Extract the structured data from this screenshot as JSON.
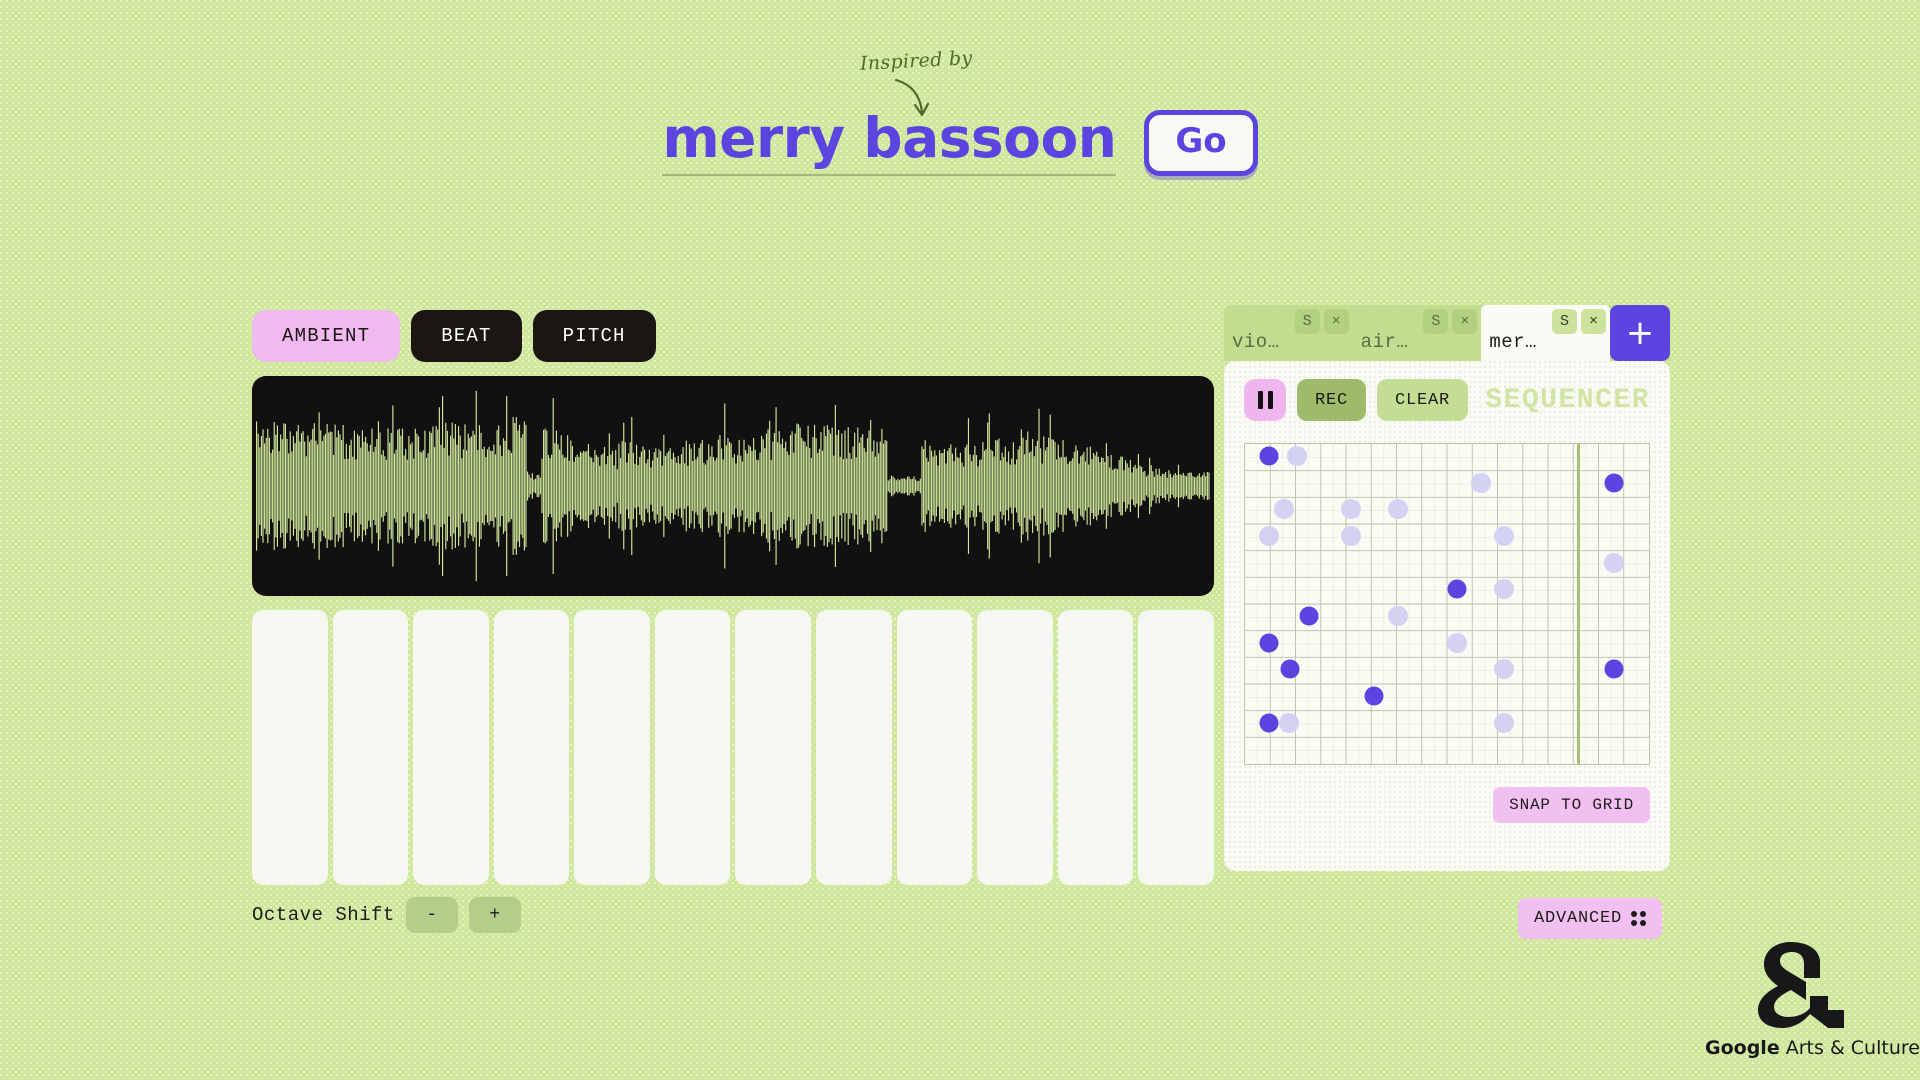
{
  "header": {
    "inspired_label": "Inspired by",
    "title": "merry bassoon",
    "go_label": "Go"
  },
  "left_panel": {
    "mode_tabs": [
      {
        "label": "AMBIENT",
        "active": true
      },
      {
        "label": "BEAT",
        "active": false
      },
      {
        "label": "PITCH",
        "active": false
      }
    ],
    "waveform": {
      "name": "audio-waveform",
      "background_color": "#121010",
      "wave_color": "#cfe79b"
    },
    "piano_keys": 12,
    "octave": {
      "label": "Octave Shift",
      "decrement_label": "-",
      "increment_label": "+"
    }
  },
  "right_panel": {
    "track_tabs": [
      {
        "name": "vio…",
        "active": false,
        "solo_label": "S",
        "close_label": "×"
      },
      {
        "name": "air…",
        "active": false,
        "solo_label": "S",
        "close_label": "×"
      },
      {
        "name": "mer…",
        "active": true,
        "solo_label": "S",
        "close_label": "×"
      }
    ],
    "add_track_label": "+",
    "sequencer": {
      "title": "SEQUENCER",
      "pause_icon": "pause-icon",
      "rec_label": "REC",
      "clear_label": "CLEAR",
      "snap_label": "SNAP TO GRID",
      "grid_columns": 16,
      "grid_rows": 12,
      "playhead_column": 13.15,
      "colors": {
        "note_active": "#5b44e0",
        "note_ghost": "#d3d2f3",
        "playhead": "#a7c172"
      },
      "notes": [
        {
          "col": 0.95,
          "row": 0.45,
          "state": "active"
        },
        {
          "col": 2.05,
          "row": 0.45,
          "state": "ghost"
        },
        {
          "col": 9.35,
          "row": 1.45,
          "state": "ghost"
        },
        {
          "col": 14.6,
          "row": 1.45,
          "state": "active"
        },
        {
          "col": 1.55,
          "row": 2.45,
          "state": "ghost"
        },
        {
          "col": 4.2,
          "row": 2.45,
          "state": "ghost"
        },
        {
          "col": 6.05,
          "row": 2.45,
          "state": "ghost"
        },
        {
          "col": 0.95,
          "row": 3.45,
          "state": "ghost"
        },
        {
          "col": 4.2,
          "row": 3.45,
          "state": "ghost"
        },
        {
          "col": 10.25,
          "row": 3.45,
          "state": "ghost"
        },
        {
          "col": 14.6,
          "row": 4.45,
          "state": "ghost"
        },
        {
          "col": 8.4,
          "row": 5.45,
          "state": "active"
        },
        {
          "col": 10.25,
          "row": 5.45,
          "state": "ghost"
        },
        {
          "col": 2.55,
          "row": 6.45,
          "state": "active"
        },
        {
          "col": 6.05,
          "row": 6.45,
          "state": "ghost"
        },
        {
          "col": 0.95,
          "row": 7.45,
          "state": "active"
        },
        {
          "col": 8.4,
          "row": 7.45,
          "state": "ghost"
        },
        {
          "col": 1.8,
          "row": 8.45,
          "state": "active"
        },
        {
          "col": 10.25,
          "row": 8.45,
          "state": "ghost"
        },
        {
          "col": 14.6,
          "row": 8.45,
          "state": "active"
        },
        {
          "col": 5.1,
          "row": 9.45,
          "state": "active"
        },
        {
          "col": 0.95,
          "row": 10.45,
          "state": "active"
        },
        {
          "col": 1.75,
          "row": 10.45,
          "state": "ghost"
        },
        {
          "col": 10.25,
          "row": 10.45,
          "state": "ghost"
        }
      ]
    },
    "advanced_label": "ADVANCED"
  },
  "footer": {
    "logo_brand": "Google",
    "logo_rest": " Arts & Culture"
  },
  "theme": {
    "page_background": "#cfe79b",
    "accent_purple": "#5b44e0",
    "accent_pink": "#f0b9ef",
    "panel_white": "#fbfbf6",
    "dark": "#1a1612"
  }
}
